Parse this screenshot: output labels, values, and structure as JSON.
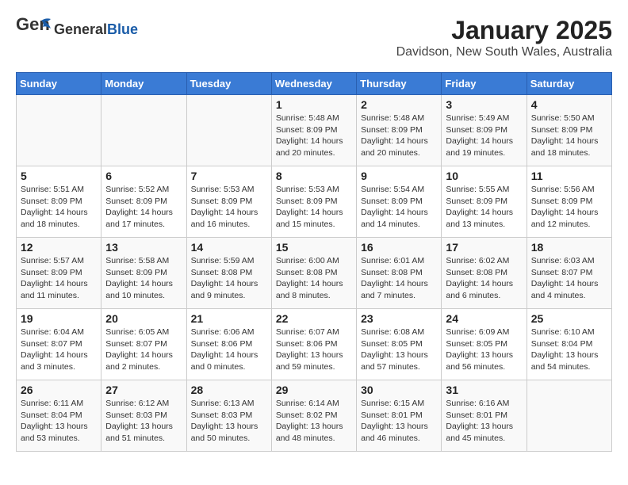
{
  "header": {
    "logo_line1": "General",
    "logo_line2": "Blue",
    "month": "January 2025",
    "location": "Davidson, New South Wales, Australia"
  },
  "weekdays": [
    "Sunday",
    "Monday",
    "Tuesday",
    "Wednesday",
    "Thursday",
    "Friday",
    "Saturday"
  ],
  "weeks": [
    [
      {
        "day": "",
        "info": ""
      },
      {
        "day": "",
        "info": ""
      },
      {
        "day": "",
        "info": ""
      },
      {
        "day": "1",
        "info": "Sunrise: 5:48 AM\nSunset: 8:09 PM\nDaylight: 14 hours\nand 20 minutes."
      },
      {
        "day": "2",
        "info": "Sunrise: 5:48 AM\nSunset: 8:09 PM\nDaylight: 14 hours\nand 20 minutes."
      },
      {
        "day": "3",
        "info": "Sunrise: 5:49 AM\nSunset: 8:09 PM\nDaylight: 14 hours\nand 19 minutes."
      },
      {
        "day": "4",
        "info": "Sunrise: 5:50 AM\nSunset: 8:09 PM\nDaylight: 14 hours\nand 18 minutes."
      }
    ],
    [
      {
        "day": "5",
        "info": "Sunrise: 5:51 AM\nSunset: 8:09 PM\nDaylight: 14 hours\nand 18 minutes."
      },
      {
        "day": "6",
        "info": "Sunrise: 5:52 AM\nSunset: 8:09 PM\nDaylight: 14 hours\nand 17 minutes."
      },
      {
        "day": "7",
        "info": "Sunrise: 5:53 AM\nSunset: 8:09 PM\nDaylight: 14 hours\nand 16 minutes."
      },
      {
        "day": "8",
        "info": "Sunrise: 5:53 AM\nSunset: 8:09 PM\nDaylight: 14 hours\nand 15 minutes."
      },
      {
        "day": "9",
        "info": "Sunrise: 5:54 AM\nSunset: 8:09 PM\nDaylight: 14 hours\nand 14 minutes."
      },
      {
        "day": "10",
        "info": "Sunrise: 5:55 AM\nSunset: 8:09 PM\nDaylight: 14 hours\nand 13 minutes."
      },
      {
        "day": "11",
        "info": "Sunrise: 5:56 AM\nSunset: 8:09 PM\nDaylight: 14 hours\nand 12 minutes."
      }
    ],
    [
      {
        "day": "12",
        "info": "Sunrise: 5:57 AM\nSunset: 8:09 PM\nDaylight: 14 hours\nand 11 minutes."
      },
      {
        "day": "13",
        "info": "Sunrise: 5:58 AM\nSunset: 8:09 PM\nDaylight: 14 hours\nand 10 minutes."
      },
      {
        "day": "14",
        "info": "Sunrise: 5:59 AM\nSunset: 8:08 PM\nDaylight: 14 hours\nand 9 minutes."
      },
      {
        "day": "15",
        "info": "Sunrise: 6:00 AM\nSunset: 8:08 PM\nDaylight: 14 hours\nand 8 minutes."
      },
      {
        "day": "16",
        "info": "Sunrise: 6:01 AM\nSunset: 8:08 PM\nDaylight: 14 hours\nand 7 minutes."
      },
      {
        "day": "17",
        "info": "Sunrise: 6:02 AM\nSunset: 8:08 PM\nDaylight: 14 hours\nand 6 minutes."
      },
      {
        "day": "18",
        "info": "Sunrise: 6:03 AM\nSunset: 8:07 PM\nDaylight: 14 hours\nand 4 minutes."
      }
    ],
    [
      {
        "day": "19",
        "info": "Sunrise: 6:04 AM\nSunset: 8:07 PM\nDaylight: 14 hours\nand 3 minutes."
      },
      {
        "day": "20",
        "info": "Sunrise: 6:05 AM\nSunset: 8:07 PM\nDaylight: 14 hours\nand 2 minutes."
      },
      {
        "day": "21",
        "info": "Sunrise: 6:06 AM\nSunset: 8:06 PM\nDaylight: 14 hours\nand 0 minutes."
      },
      {
        "day": "22",
        "info": "Sunrise: 6:07 AM\nSunset: 8:06 PM\nDaylight: 13 hours\nand 59 minutes."
      },
      {
        "day": "23",
        "info": "Sunrise: 6:08 AM\nSunset: 8:05 PM\nDaylight: 13 hours\nand 57 minutes."
      },
      {
        "day": "24",
        "info": "Sunrise: 6:09 AM\nSunset: 8:05 PM\nDaylight: 13 hours\nand 56 minutes."
      },
      {
        "day": "25",
        "info": "Sunrise: 6:10 AM\nSunset: 8:04 PM\nDaylight: 13 hours\nand 54 minutes."
      }
    ],
    [
      {
        "day": "26",
        "info": "Sunrise: 6:11 AM\nSunset: 8:04 PM\nDaylight: 13 hours\nand 53 minutes."
      },
      {
        "day": "27",
        "info": "Sunrise: 6:12 AM\nSunset: 8:03 PM\nDaylight: 13 hours\nand 51 minutes."
      },
      {
        "day": "28",
        "info": "Sunrise: 6:13 AM\nSunset: 8:03 PM\nDaylight: 13 hours\nand 50 minutes."
      },
      {
        "day": "29",
        "info": "Sunrise: 6:14 AM\nSunset: 8:02 PM\nDaylight: 13 hours\nand 48 minutes."
      },
      {
        "day": "30",
        "info": "Sunrise: 6:15 AM\nSunset: 8:01 PM\nDaylight: 13 hours\nand 46 minutes."
      },
      {
        "day": "31",
        "info": "Sunrise: 6:16 AM\nSunset: 8:01 PM\nDaylight: 13 hours\nand 45 minutes."
      },
      {
        "day": "",
        "info": ""
      }
    ]
  ]
}
